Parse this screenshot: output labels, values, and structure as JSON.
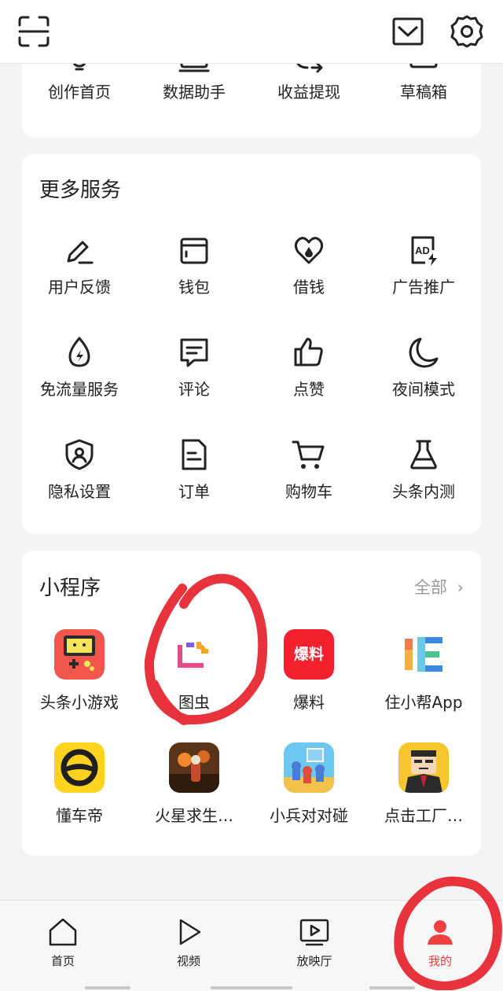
{
  "colors": {
    "accent": "#f04142",
    "annotation": "#e8323c"
  },
  "top_bar": {
    "scan_icon": "scan-icon",
    "mail_icon": "mail-icon",
    "settings_icon": "gear-icon"
  },
  "creator_tools": [
    {
      "label": "创作首页",
      "icon": "bulb-icon"
    },
    {
      "label": "数据助手",
      "icon": "monitor-icon"
    },
    {
      "label": "收益提现",
      "icon": "withdraw-icon"
    },
    {
      "label": "草稿箱",
      "icon": "draft-box-icon"
    }
  ],
  "more_services": {
    "title": "更多服务",
    "items": [
      {
        "label": "用户反馈",
        "icon": "pen-icon"
      },
      {
        "label": "钱包",
        "icon": "wallet-icon"
      },
      {
        "label": "借钱",
        "icon": "loan-icon"
      },
      {
        "label": "广告推广",
        "icon": "ad-icon"
      },
      {
        "label": "免流量服务",
        "icon": "data-drop-icon"
      },
      {
        "label": "评论",
        "icon": "comment-icon"
      },
      {
        "label": "点赞",
        "icon": "thumbs-up-icon"
      },
      {
        "label": "夜间模式",
        "icon": "moon-icon"
      },
      {
        "label": "隐私设置",
        "icon": "shield-user-icon"
      },
      {
        "label": "订单",
        "icon": "document-icon"
      },
      {
        "label": "购物车",
        "icon": "cart-icon"
      },
      {
        "label": "头条内测",
        "icon": "flask-icon"
      }
    ]
  },
  "mini_programs": {
    "title": "小程序",
    "more_label": "全部",
    "items": [
      {
        "label": "头条小游戏",
        "icon": "game-console-icon"
      },
      {
        "label": "图虫",
        "icon": "tuchong-icon"
      },
      {
        "label": "爆料",
        "icon": "baoliao-icon",
        "icon_text": "爆料"
      },
      {
        "label": "住小帮App",
        "icon": "zhuxiaobang-icon"
      },
      {
        "label": "懂车帝",
        "icon": "dongchedi-icon"
      },
      {
        "label": "火星求生…",
        "icon": "astronaut-icon"
      },
      {
        "label": "小兵对对碰",
        "icon": "soldiers-icon"
      },
      {
        "label": "点击工厂…",
        "icon": "boss-icon"
      }
    ]
  },
  "tab_bar": {
    "active": "我的",
    "tabs": [
      {
        "label": "首页",
        "icon": "home-icon"
      },
      {
        "label": "视频",
        "icon": "play-icon"
      },
      {
        "label": "放映厅",
        "icon": "screen-play-icon"
      },
      {
        "label": "我的",
        "icon": "user-icon"
      }
    ]
  }
}
